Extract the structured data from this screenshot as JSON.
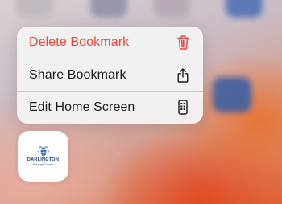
{
  "colors": {
    "destructive": "#e8453c",
    "text": "#1c1c1e",
    "menu_background": "#f4f2f4",
    "brand_blue": "#1d3f7a"
  },
  "context_menu": {
    "items": [
      {
        "label": "Delete Bookmark",
        "icon": "trash-icon",
        "destructive": true
      },
      {
        "label": "Share Bookmark",
        "icon": "share-icon",
        "destructive": false
      },
      {
        "label": "Edit Home Screen",
        "icon": "phone-icon",
        "destructive": false
      }
    ]
  },
  "bookmark": {
    "name": "DARLINGTON",
    "subtitle": "Borough Council",
    "icon": "crest-icon"
  }
}
